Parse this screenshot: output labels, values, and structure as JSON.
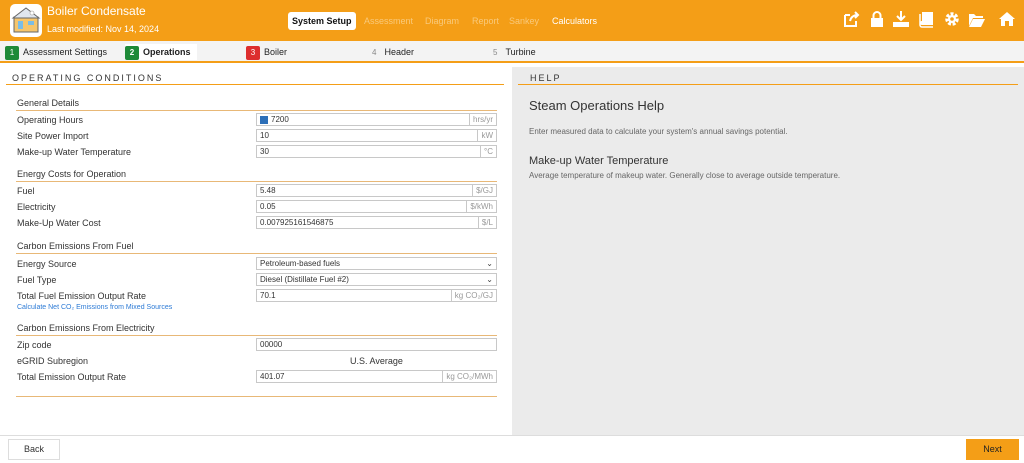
{
  "app": {
    "title": "Boiler Condensate",
    "modified": "Last modified: Nov 14, 2024"
  },
  "nav": {
    "tabs": [
      "System Setup",
      "Assessment",
      "Diagram",
      "Report",
      "Sankey",
      "Calculators"
    ],
    "active": "System Setup"
  },
  "toolbar": {
    "icons": [
      "share-icon",
      "lock-icon",
      "download-icon",
      "book-icon",
      "gear-icon",
      "folder-open-icon",
      "home-icon"
    ]
  },
  "steps": [
    {
      "num": "1",
      "label": "Assessment Settings",
      "status": "complete"
    },
    {
      "num": "2",
      "label": "Operations",
      "status": "active"
    },
    {
      "num": "3",
      "label": "Boiler",
      "status": "error"
    },
    {
      "num": "4",
      "label": "Header",
      "status": "pending"
    },
    {
      "num": "5",
      "label": "Turbine",
      "status": "pending"
    }
  ],
  "operating": {
    "heading": "OPERATING CONDITIONS",
    "general": {
      "title": "General Details",
      "operating_hours": {
        "label": "Operating Hours",
        "value": "7200",
        "unit": "hrs/yr"
      },
      "site_power": {
        "label": "Site Power Import",
        "value": "10",
        "unit": "kW"
      },
      "makeup_temp": {
        "label": "Make-up Water Temperature",
        "value": "30",
        "unit": "°C"
      }
    },
    "energy": {
      "title": "Energy Costs for Operation",
      "fuel": {
        "label": "Fuel",
        "value": "5.48",
        "unit": "$/GJ"
      },
      "electricity": {
        "label": "Electricity",
        "value": "0.05",
        "unit": "$/kWh"
      },
      "water_cost": {
        "label": "Make-Up Water Cost",
        "value": "0.007925161546875",
        "unit": "$/L"
      }
    },
    "carbon_fuel": {
      "title": "Carbon Emissions From Fuel",
      "energy_source": {
        "label": "Energy Source",
        "value": "Petroleum-based fuels"
      },
      "fuel_type": {
        "label": "Fuel Type",
        "value": "Diesel (Distillate Fuel #2)"
      },
      "output_rate": {
        "label": "Total Fuel Emission Output Rate",
        "value": "70.1",
        "unit": "kg CO₂/GJ"
      },
      "link": "Calculate Net CO₂ Emissions from Mixed Sources"
    },
    "carbon_elec": {
      "title": "Carbon Emissions From Electricity",
      "zip": {
        "label": "Zip code",
        "value": "00000"
      },
      "egrid": {
        "label": "eGRID Subregion",
        "value": "U.S. Average"
      },
      "output_rate": {
        "label": "Total Emission Output Rate",
        "value": "401.07",
        "unit": "kg CO₂/MWh"
      }
    }
  },
  "help": {
    "heading": "HELP",
    "title": "Steam Operations Help",
    "intro": "Enter measured data to calculate your system's annual savings potential.",
    "sub_title": "Make-up Water Temperature",
    "sub_desc": "Average temperature of makeup water. Generally close to average outside temperature."
  },
  "footer": {
    "back": "Back",
    "next": "Next"
  },
  "colors": {
    "accent": "#F49E17",
    "complete": "#1E8A38",
    "error": "#DD2E2E",
    "link": "#2D7BD6"
  }
}
